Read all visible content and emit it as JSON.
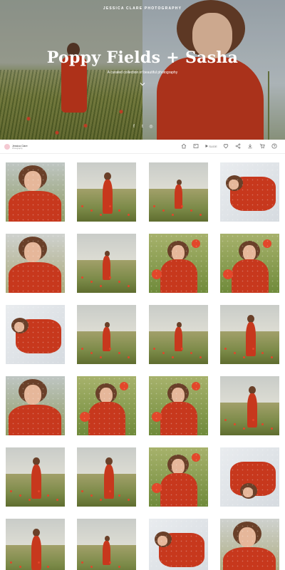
{
  "hero": {
    "brand": "JESSICA CLARE PHOTOGRAPHY",
    "title": "Poppy Fields + Sasha",
    "subtitle": "A curated collection of beautiful photography",
    "scroll_icon": "chevron-down-icon",
    "social": [
      "facebook-icon",
      "twitter-icon",
      "instagram-icon"
    ]
  },
  "toolbar": {
    "logo_name": "Jessica Clare",
    "logo_sub": "Photography",
    "slideshow_label": "SLIDE",
    "tools": [
      "home-icon",
      "images-icon",
      "slideshow-button",
      "heart-icon",
      "share-icon",
      "download-icon",
      "cart-icon",
      "help-icon"
    ]
  },
  "colors": {
    "accent_red": "#c7381d",
    "hero_overlay": "rgba(0,0,0,0.12)",
    "field_green": "#7b8a48"
  },
  "gallery": {
    "columns": 4,
    "rows": 6,
    "items": [
      {
        "scene": "closeup-hand"
      },
      {
        "scene": "standing-field"
      },
      {
        "scene": "distant-field"
      },
      {
        "scene": "lying-sheet"
      },
      {
        "scene": "portrait-hat"
      },
      {
        "scene": "distant-field"
      },
      {
        "scene": "poppy-closeup"
      },
      {
        "scene": "crouch-poppies"
      },
      {
        "scene": "lying-sheet"
      },
      {
        "scene": "distant-field"
      },
      {
        "scene": "distant-field"
      },
      {
        "scene": "standing-field"
      },
      {
        "scene": "closeup-hand"
      },
      {
        "scene": "crouch-poppies"
      },
      {
        "scene": "poppy-closeup"
      },
      {
        "scene": "dancing-field"
      },
      {
        "scene": "standing-field"
      },
      {
        "scene": "dancing-field"
      },
      {
        "scene": "crouch-poppies"
      },
      {
        "scene": "lying-upside"
      },
      {
        "scene": "standing-field"
      },
      {
        "scene": "distant-field"
      },
      {
        "scene": "lying-sheet"
      },
      {
        "scene": "portrait-hat"
      }
    ]
  }
}
